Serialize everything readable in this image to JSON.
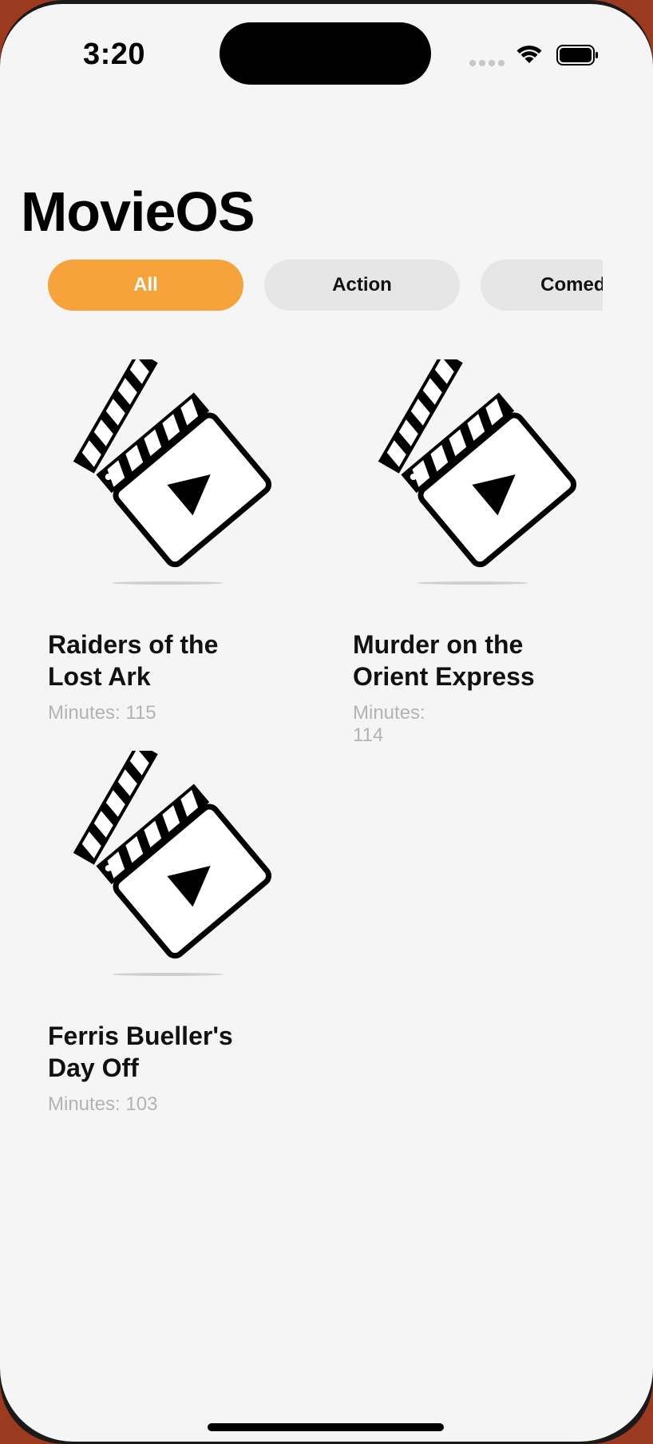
{
  "status_bar": {
    "time": "3:20"
  },
  "app": {
    "title": "MovieOS"
  },
  "filters": [
    {
      "label": "All",
      "selected": true
    },
    {
      "label": "Action",
      "selected": false
    },
    {
      "label": "Comedy",
      "selected": false
    }
  ],
  "movies": [
    {
      "title_line1": "Raiders of the",
      "title_line2": "Lost Ark",
      "minutes": "Minutes: 115",
      "icon": "clapperboard-icon"
    },
    {
      "title_line1": "Murder on the",
      "title_line2": "Orient Express",
      "minutes": "Minutes: 114",
      "icon": "clapperboard-icon"
    },
    {
      "title_line1": "Ferris Bueller's",
      "title_line2": "Day Off",
      "minutes": "Minutes: 103",
      "icon": "clapperboard-icon"
    }
  ],
  "colors": {
    "accent": "#f5a33a",
    "chip_inactive": "#e6e6e6",
    "background": "#f5f5f5",
    "muted_text": "#b3b3b3"
  }
}
